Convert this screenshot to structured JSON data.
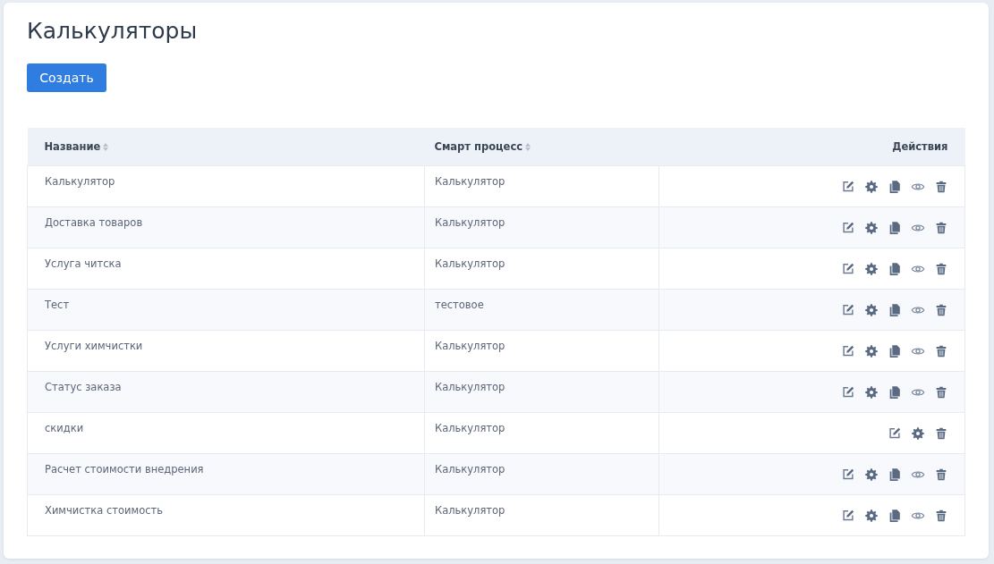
{
  "page": {
    "title": "Калькуляторы"
  },
  "create_button": {
    "label": "Создать"
  },
  "table": {
    "columns": [
      {
        "label": "Название",
        "sortable": true
      },
      {
        "label": "Смарт процесс",
        "sortable": true
      },
      {
        "label": "Действия",
        "sortable": false
      }
    ],
    "rows": [
      {
        "name": "Калькулятор",
        "process": "Калькулятор",
        "can_copy": true,
        "can_view": true
      },
      {
        "name": "Доставка товаров",
        "process": "Калькулятор",
        "can_copy": true,
        "can_view": true
      },
      {
        "name": "Услуга читска",
        "process": "Калькулятор",
        "can_copy": true,
        "can_view": true
      },
      {
        "name": "Тест",
        "process": "тестовое",
        "can_copy": true,
        "can_view": true
      },
      {
        "name": "Услуги химчистки",
        "process": "Калькулятор",
        "can_copy": true,
        "can_view": true
      },
      {
        "name": "Статус заказа",
        "process": "Калькулятор",
        "can_copy": true,
        "can_view": true
      },
      {
        "name": "скидки",
        "process": "Калькулятор",
        "can_copy": false,
        "can_view": false
      },
      {
        "name": "Расчет стоимости внедрения",
        "process": "Калькулятор",
        "can_copy": true,
        "can_view": true
      },
      {
        "name": "Химчистка стоимость",
        "process": "Калькулятор",
        "can_copy": true,
        "can_view": true
      }
    ]
  }
}
